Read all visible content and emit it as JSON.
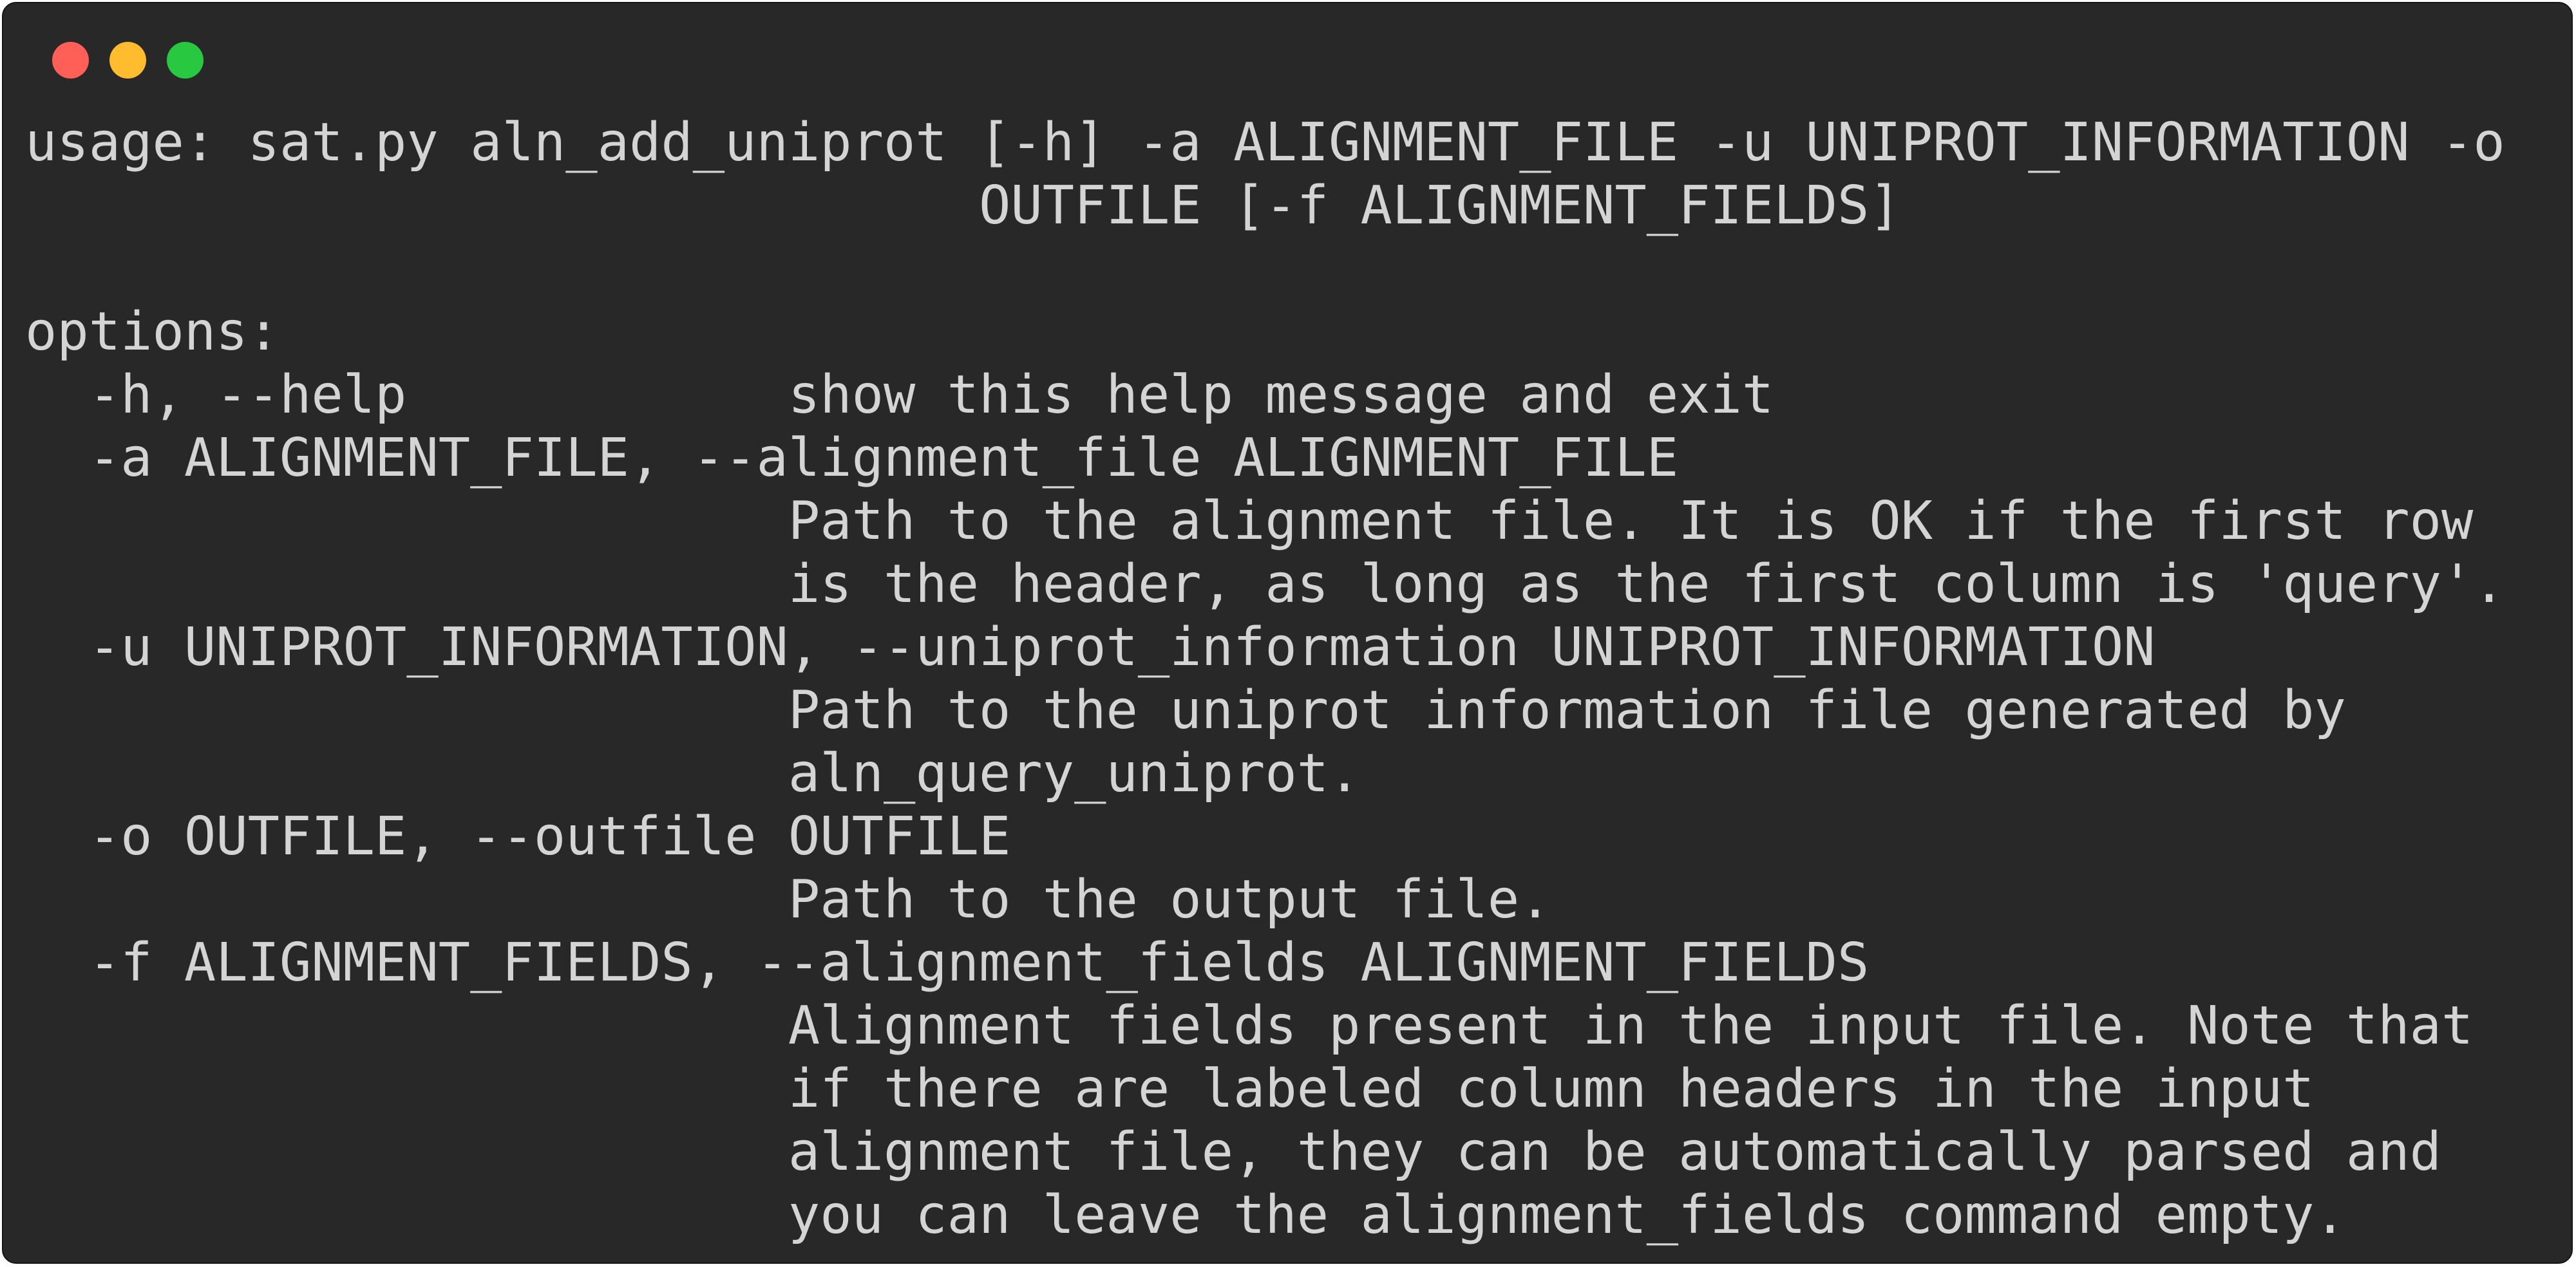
{
  "window": {
    "controls": {
      "close_color": "#ff5f57",
      "minimize_color": "#febc2e",
      "maximize_color": "#28c840"
    }
  },
  "terminal": {
    "background": "#282828",
    "foreground": "#d4d4d4",
    "lines": [
      "usage: sat.py aln_add_uniprot [-h] -a ALIGNMENT_FILE -u UNIPROT_INFORMATION -o",
      "                              OUTFILE [-f ALIGNMENT_FIELDS]",
      "",
      "options:",
      "  -h, --help            show this help message and exit",
      "  -a ALIGNMENT_FILE, --alignment_file ALIGNMENT_FILE",
      "                        Path to the alignment file. It is OK if the first row",
      "                        is the header, as long as the first column is 'query'.",
      "  -u UNIPROT_INFORMATION, --uniprot_information UNIPROT_INFORMATION",
      "                        Path to the uniprot information file generated by",
      "                        aln_query_uniprot.",
      "  -o OUTFILE, --outfile OUTFILE",
      "                        Path to the output file.",
      "  -f ALIGNMENT_FIELDS, --alignment_fields ALIGNMENT_FIELDS",
      "                        Alignment fields present in the input file. Note that",
      "                        if there are labeled column headers in the input",
      "                        alignment file, they can be automatically parsed and",
      "                        you can leave the alignment_fields command empty."
    ]
  }
}
